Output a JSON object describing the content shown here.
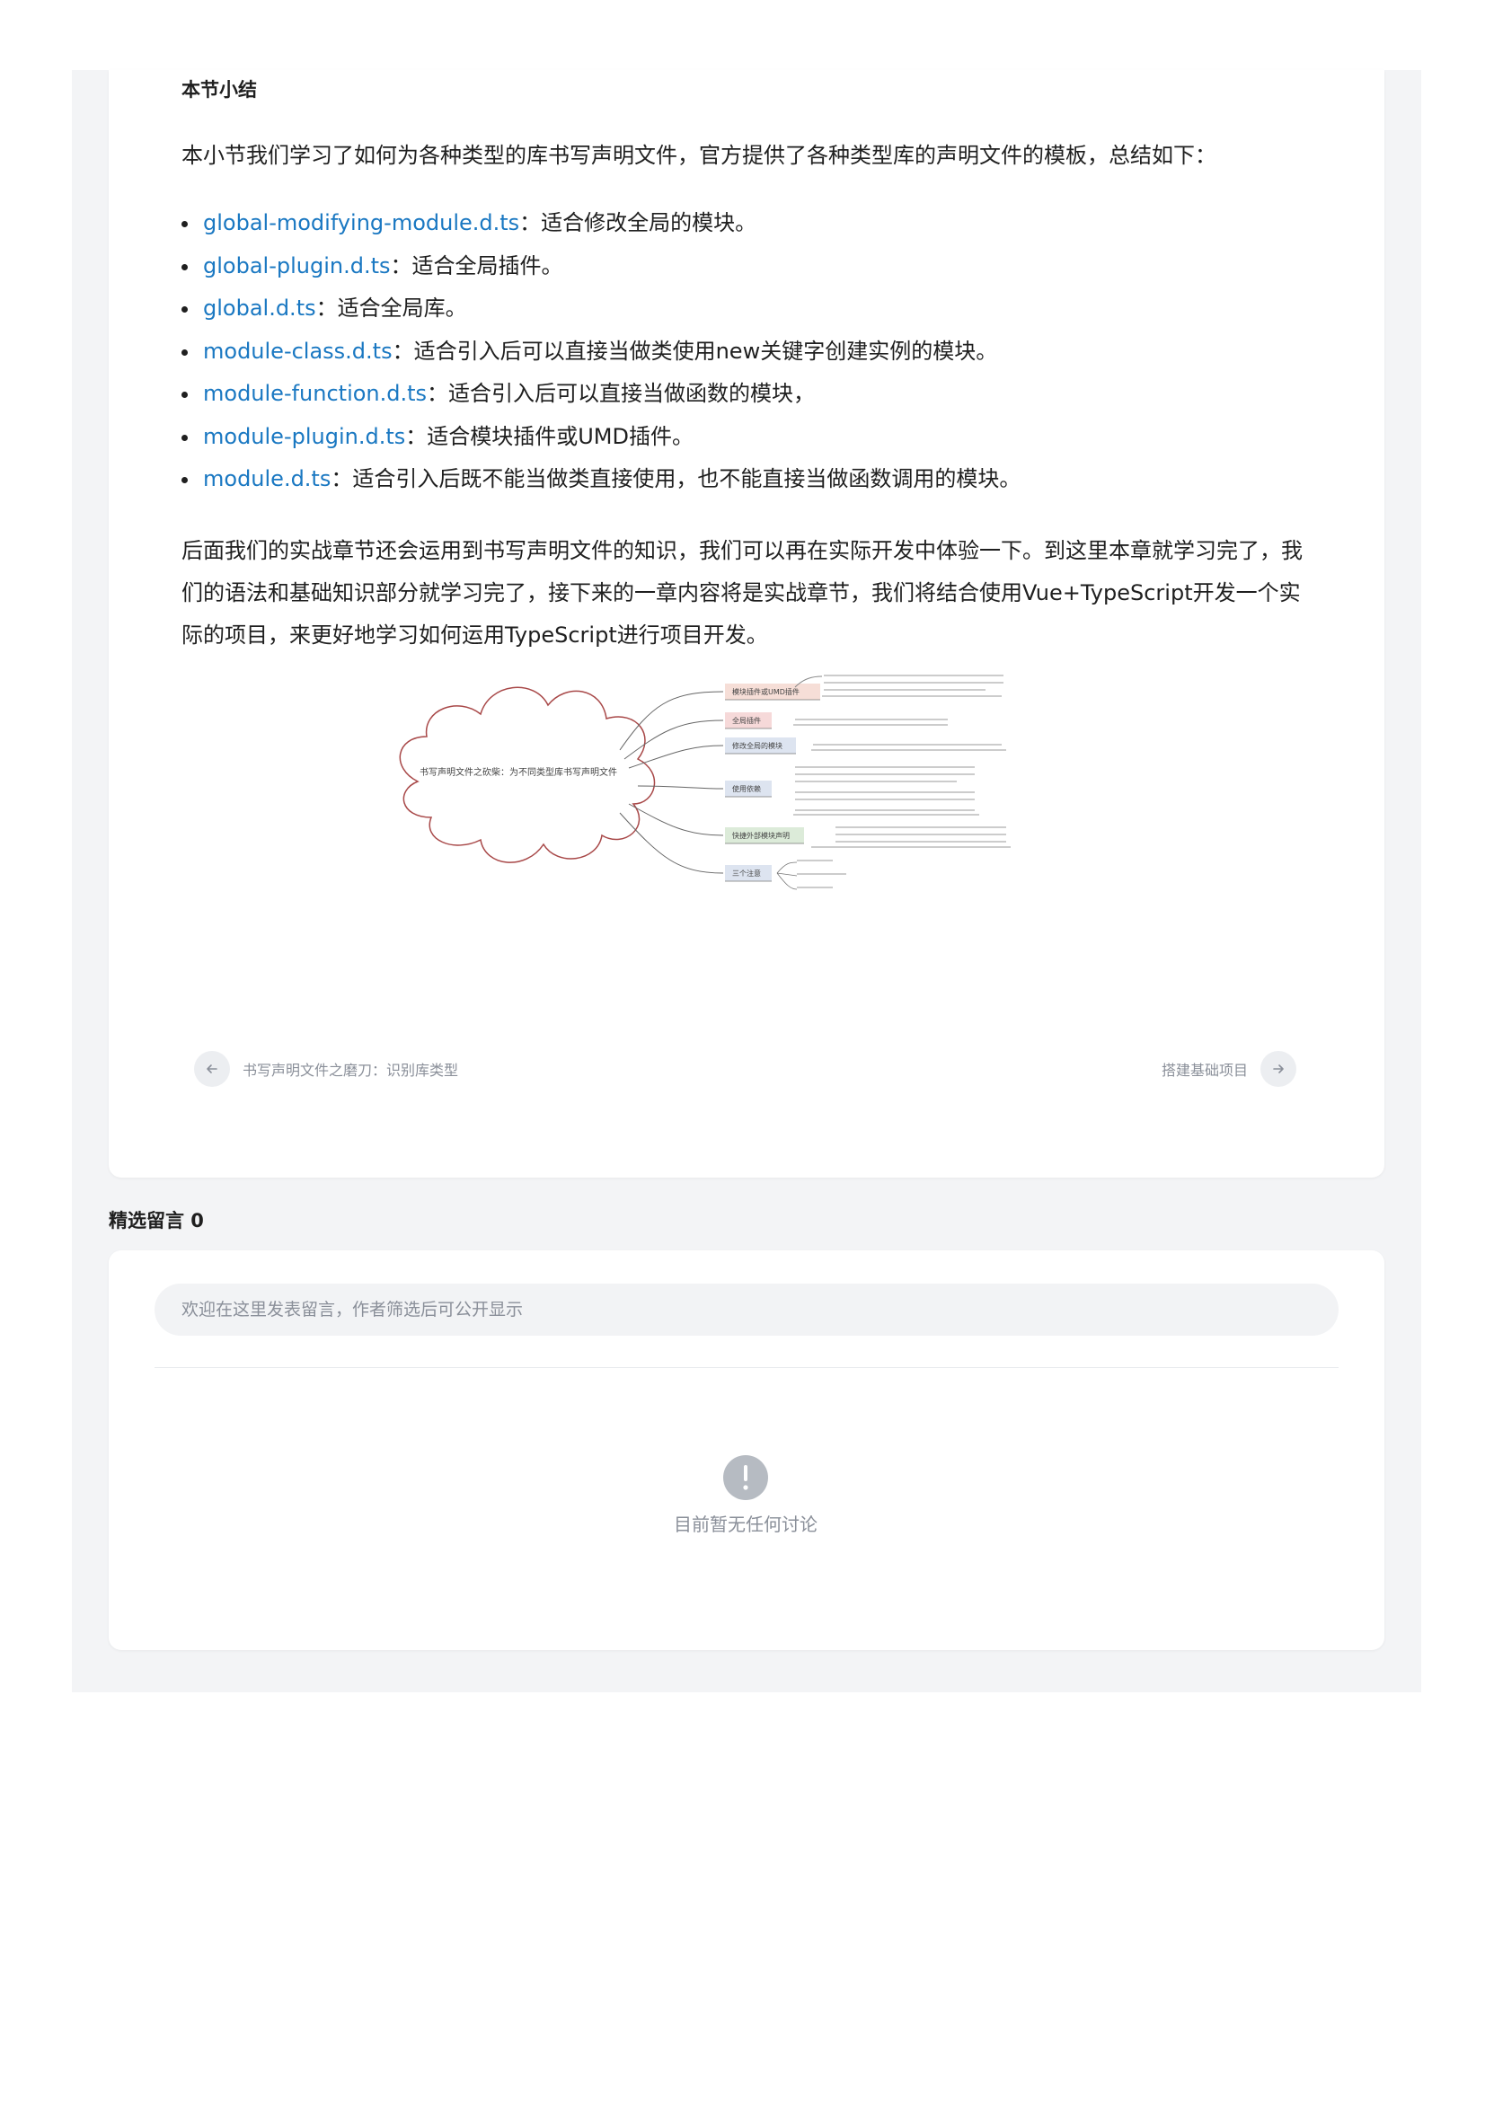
{
  "article": {
    "section_heading": "本节小结",
    "intro": "本小节我们学习了如何为各种类型的库书写声明文件，官方提供了各种类型库的声明文件的模板，总结如下：",
    "templates": [
      {
        "name": "global-modifying-module.d.ts",
        "desc": "：适合修改全局的模块。"
      },
      {
        "name": "global-plugin.d.ts",
        "desc": "：适合全局插件。"
      },
      {
        "name": "global.d.ts",
        "desc": "：适合全局库。"
      },
      {
        "name": "module-class.d.ts",
        "desc": "：适合引入后可以直接当做类使用new关键字创建实例的模块。"
      },
      {
        "name": "module-function.d.ts",
        "desc": "：适合引入后可以直接当做函数的模块，"
      },
      {
        "name": "module-plugin.d.ts",
        "desc": "：适合模块插件或UMD插件。"
      },
      {
        "name": "module.d.ts",
        "desc": "：适合引入后既不能当做类直接使用，也不能直接当做函数调用的模块。"
      }
    ],
    "closing": "后面我们的实战章节还会运用到书写声明文件的知识，我们可以再在实际开发中体验一下。到这里本章就学习完了，我们的语法和基础知识部分就学习完了，接下来的一章内容将是实战章节，我们将结合使用Vue+TypeScript开发一个实际的项目，来更好地学习如何运用TypeScript进行项目开发。"
  },
  "mindmap": {
    "root": "书写声明文件之砍柴：为不同类型库书写声明文件",
    "branches": [
      {
        "label": "模块插件或UMD插件",
        "color": "#f6ded7"
      },
      {
        "label": "全局插件",
        "color": "#f6d9d9"
      },
      {
        "label": "修改全局的模块",
        "color": "#dde4f0"
      },
      {
        "label": "使用依赖",
        "color": "#dde4f0"
      },
      {
        "label": "快捷外部模块声明",
        "color": "#dcebd9"
      },
      {
        "label": "三个注意",
        "color": "#dde4f0"
      }
    ]
  },
  "pager": {
    "prev": "书写声明文件之磨刀：识别库类型",
    "next": "搭建基础项目"
  },
  "comments": {
    "title": "精选留言 0",
    "placeholder": "欢迎在这里发表留言，作者筛选后可公开显示",
    "empty_text": "目前暂无任何讨论"
  }
}
